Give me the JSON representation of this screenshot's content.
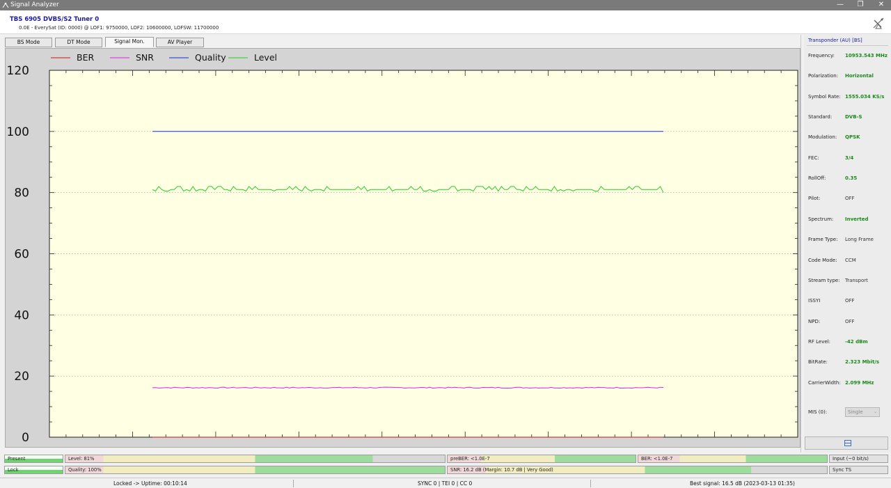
{
  "window": {
    "title": "Signal Analyzer",
    "minimize": "—",
    "restore": "❐",
    "close": "✕"
  },
  "header": {
    "device": "TBS 6905 DVBS/S2 Tuner 0",
    "satellite": "0.0E - EverySat (ID: 0000) @ LOF1: 9750000, LOF2: 10600000, LOFSW: 11700000"
  },
  "tabs": [
    {
      "label": "BS Mode",
      "active": false
    },
    {
      "label": "DT Mode",
      "active": false
    },
    {
      "label": "Signal Mon.",
      "active": true
    },
    {
      "label": "AV Player",
      "active": false
    }
  ],
  "chart_data": {
    "type": "line",
    "title": "",
    "xlabel": "",
    "ylabel": "",
    "ylim": [
      0,
      120
    ],
    "yticks": [
      0,
      20,
      40,
      60,
      80,
      100,
      120
    ],
    "grid": true,
    "legend_position": "top-left",
    "x_samples": 165,
    "series": [
      {
        "name": "BER",
        "color": "#d01010",
        "values": [
          0
        ]
      },
      {
        "name": "SNR",
        "color": "#e020e0",
        "values": [
          16.2
        ]
      },
      {
        "name": "Quality",
        "color": "#1030d0",
        "values": [
          100
        ]
      },
      {
        "name": "Level",
        "color": "#20d020",
        "values": [
          81
        ]
      }
    ]
  },
  "transponder": {
    "title": "Transponder (AU) [BS]",
    "props": [
      {
        "label": "Frequency:",
        "value": "10953.543 MHz",
        "style": "green"
      },
      {
        "label": "Polarization:",
        "value": "Horizontal",
        "style": "green"
      },
      {
        "label": "Symbol Rate:",
        "value": "1555.034 KS/s",
        "style": "green"
      },
      {
        "label": "Standard:",
        "value": "DVB-S",
        "style": "green"
      },
      {
        "label": "Modulation:",
        "value": "QPSK",
        "style": "green"
      },
      {
        "label": "FEC:",
        "value": "3/4",
        "style": "green"
      },
      {
        "label": "RollOff:",
        "value": "0.35",
        "style": "green"
      },
      {
        "label": "Pilot:",
        "value": "OFF",
        "style": "gray"
      },
      {
        "label": "Spectrum:",
        "value": "Inverted",
        "style": "green"
      },
      {
        "label": "Frame Type:",
        "value": "Long Frame",
        "style": "gray"
      },
      {
        "label": "Code Mode:",
        "value": "CCM",
        "style": "gray"
      },
      {
        "label": "Stream type:",
        "value": "Transport",
        "style": "gray"
      },
      {
        "label": "ISSYI",
        "value": "OFF",
        "style": "gray"
      },
      {
        "label": "NPD:",
        "value": "OFF",
        "style": "gray"
      },
      {
        "label": "RF Level:",
        "value": "-42 dBm",
        "style": "green"
      },
      {
        "label": "BitRate:",
        "value": "2.323 Mbit/s",
        "style": "green"
      },
      {
        "label": "CarrierWidth:",
        "value": "2.099 MHz",
        "style": "green"
      }
    ],
    "mis_label": "MIS (0):",
    "mis_value": "Single"
  },
  "status": {
    "present": "Present",
    "lock": "Lock",
    "level": "Level: 81%",
    "level_value": 0.81,
    "quality": "Quality: 100%",
    "quality_value": 1.0,
    "preber": "preBER: <1.0E-7",
    "snr": "SNR: 16.2 dB (Margin: 10.7 dB | Very Good)",
    "ber": "BER: <1.0E-7",
    "input": "Input (~0 bit/s)",
    "sync": "Sync TS"
  },
  "footer": {
    "uptime": "Locked -> Uptime: 00:10:14",
    "sync": "SYNC 0 | TEI 0 | CC 0",
    "best": "Best signal: 16.5 dB (2023-03-13 01:35)"
  }
}
